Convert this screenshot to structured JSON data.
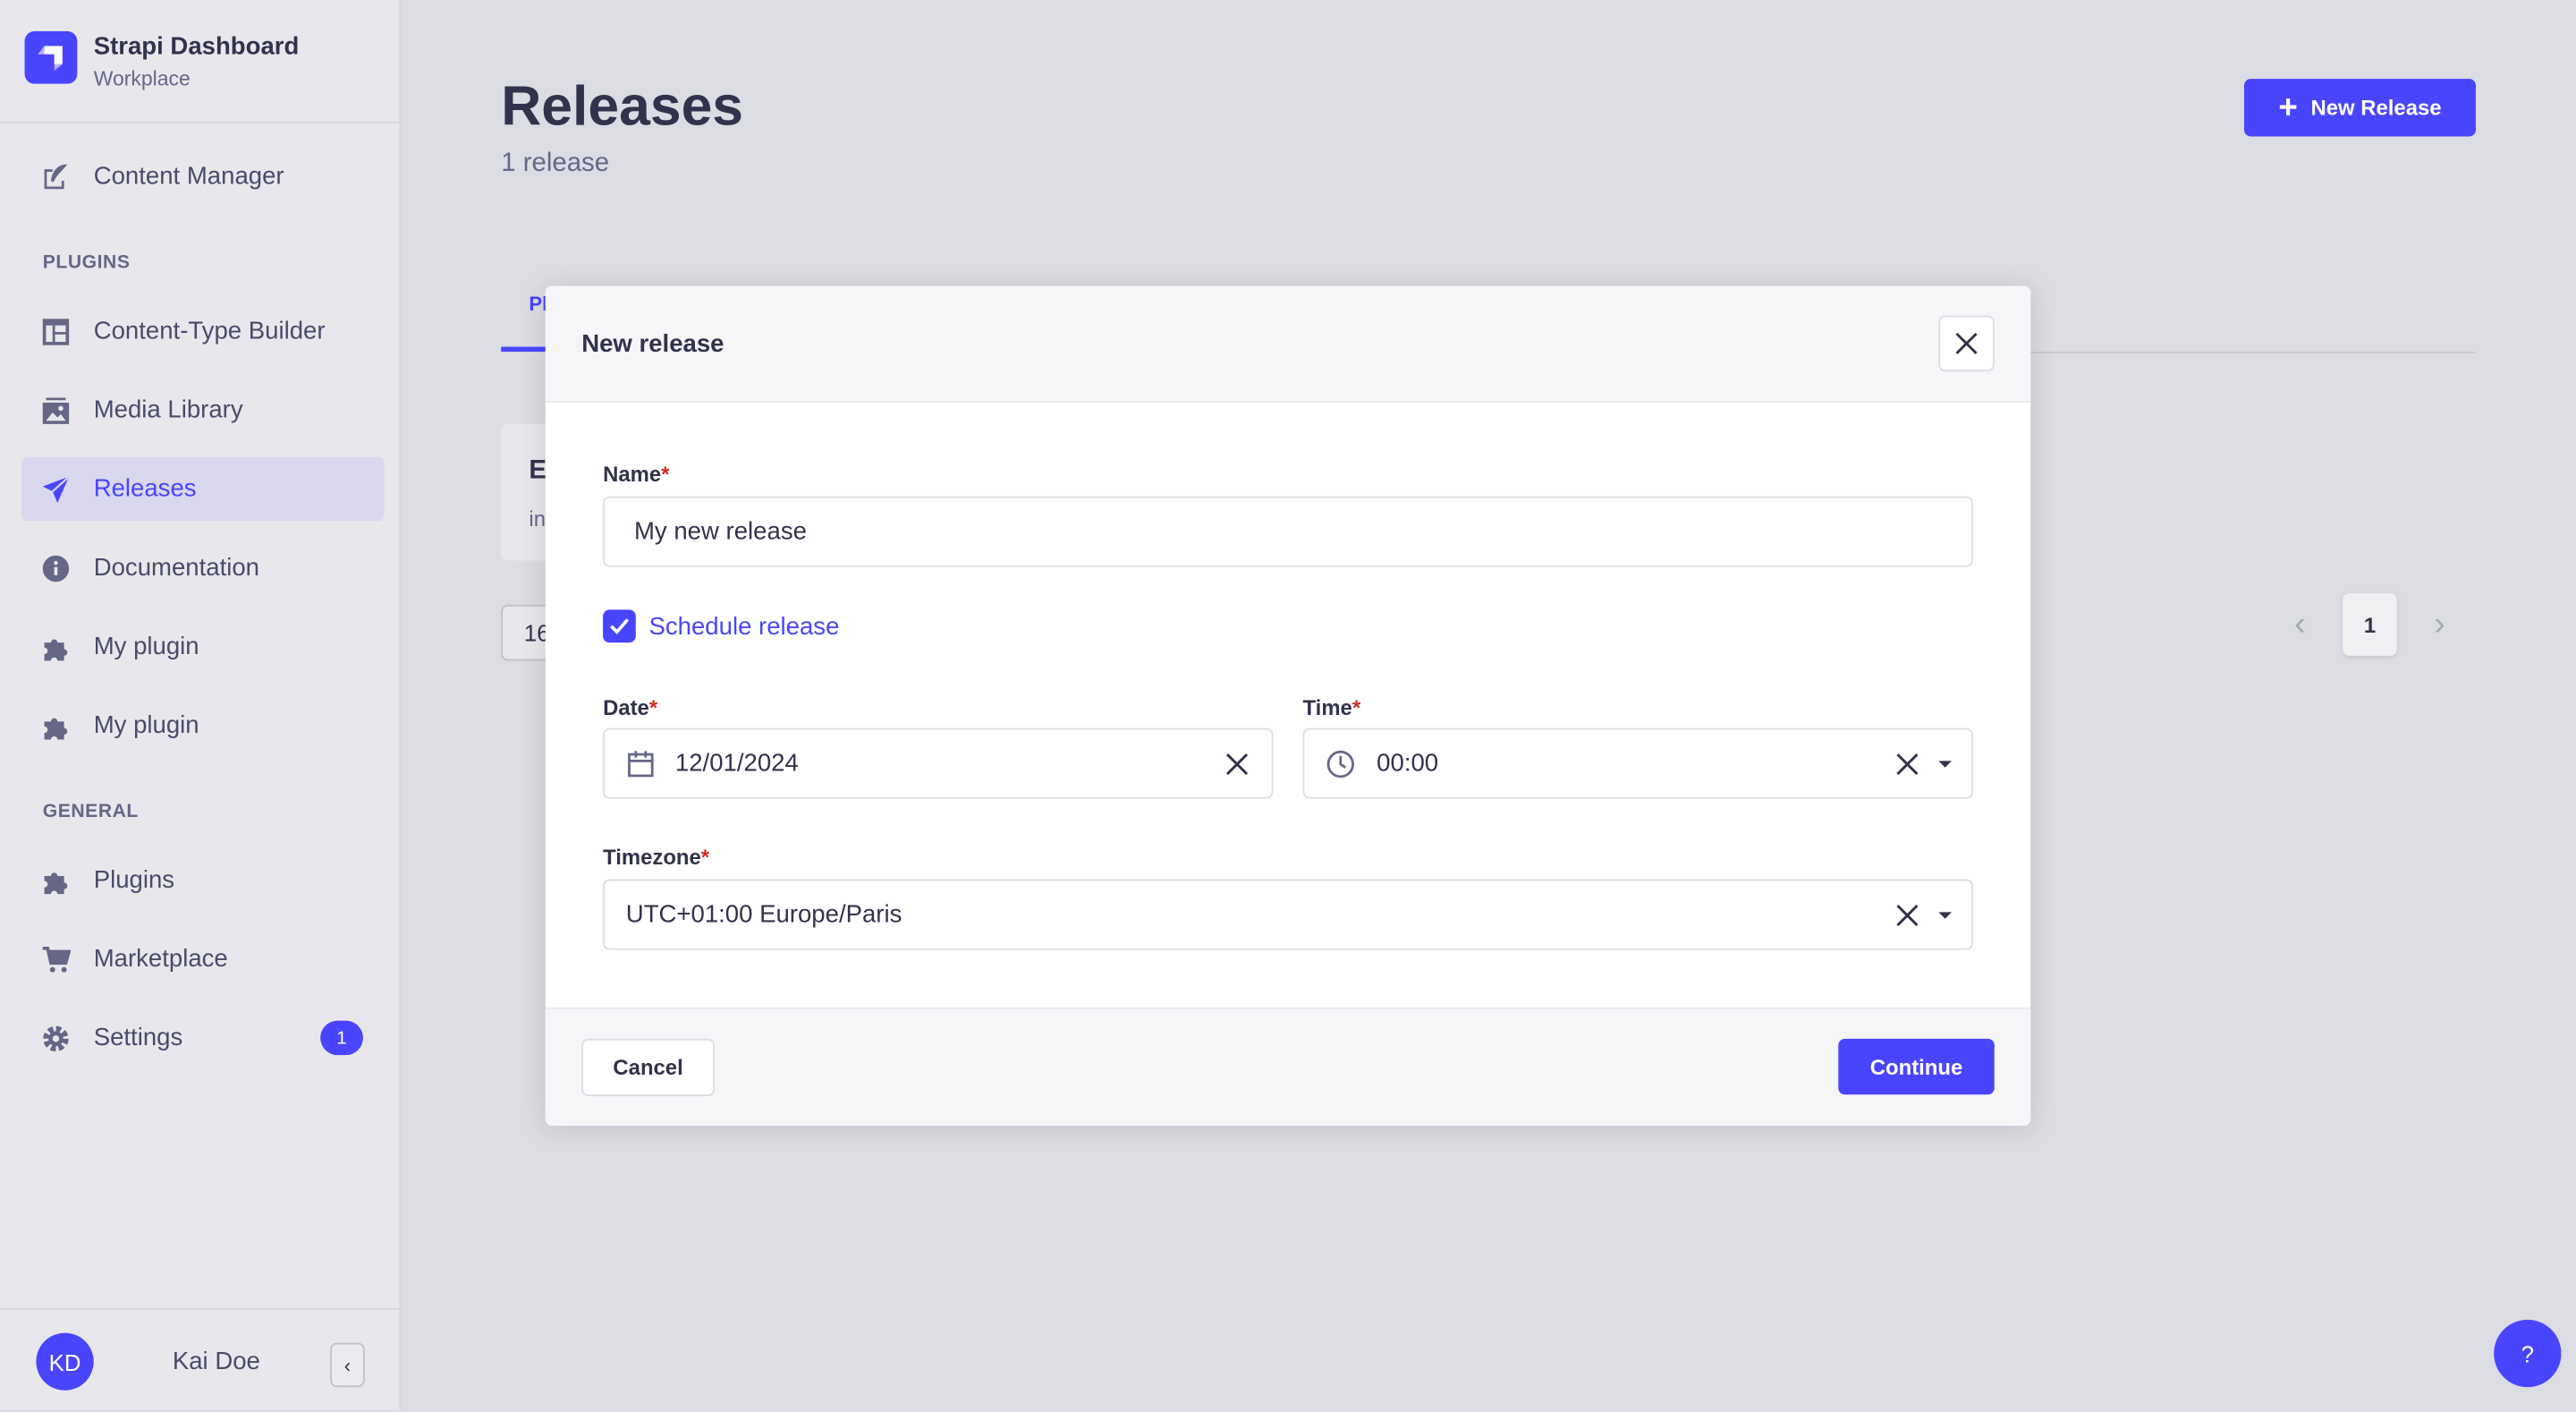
{
  "brand": {
    "title": "Strapi Dashboard",
    "subtitle": "Workplace"
  },
  "sidebar": {
    "content_manager": "Content Manager",
    "plugins_heading": "PLUGINS",
    "plugins": [
      {
        "label": "Content-Type Builder",
        "icon": "layout-icon"
      },
      {
        "label": "Media Library",
        "icon": "image-icon"
      },
      {
        "label": "Releases",
        "icon": "paper-plane-icon",
        "active": true
      },
      {
        "label": "Documentation",
        "icon": "info-icon"
      },
      {
        "label": "My plugin",
        "icon": "puzzle-icon"
      },
      {
        "label": "My plugin",
        "icon": "puzzle-icon"
      }
    ],
    "general_heading": "GENERAL",
    "general": [
      {
        "label": "Plugins",
        "icon": "puzzle-icon"
      },
      {
        "label": "Marketplace",
        "icon": "cart-icon"
      },
      {
        "label": "Settings",
        "icon": "gear-icon",
        "badge": "1"
      }
    ],
    "user": {
      "initials": "KD",
      "name": "Kai Doe"
    }
  },
  "page": {
    "title": "Releases",
    "subtitle": "1 release",
    "new_button": "New Release",
    "tab_fragment": "Pl",
    "card_fragment_title": "E",
    "card_fragment_text": "in",
    "select_fragment": "16",
    "current_page": "1",
    "help": "?"
  },
  "modal": {
    "title": "New release",
    "name_label": "Name",
    "name_value": "My new release",
    "schedule_label": "Schedule release",
    "schedule_checked": true,
    "date_label": "Date",
    "date_value": "12/01/2024",
    "time_label": "Time",
    "time_value": "00:00",
    "timezone_label": "Timezone",
    "timezone_value": "UTC+01:00 Europe/Paris",
    "required_mark": "*",
    "cancel": "Cancel",
    "continue": "Continue"
  },
  "colors": {
    "primary": "#4945ff",
    "required": "#d02b20",
    "text": "#32324d"
  }
}
